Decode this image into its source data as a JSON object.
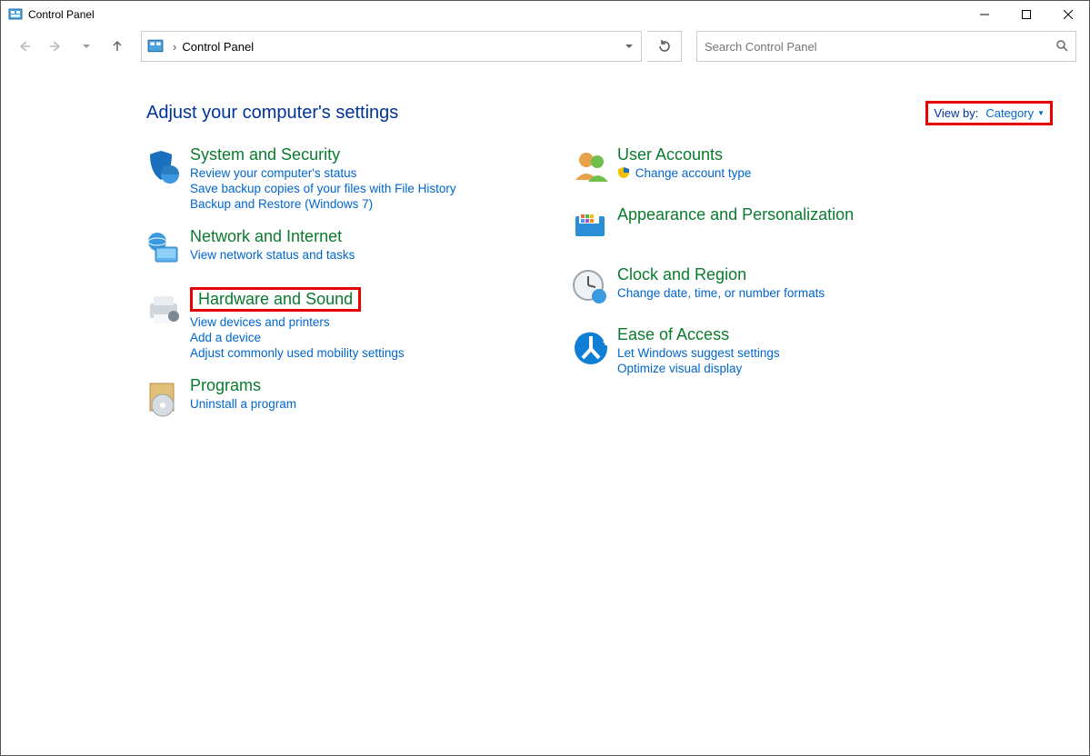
{
  "window": {
    "title": "Control Panel"
  },
  "address": {
    "location": "Control Panel"
  },
  "search": {
    "placeholder": "Search Control Panel"
  },
  "header": {
    "heading": "Adjust your computer's settings"
  },
  "viewby": {
    "label": "View by:",
    "value": "Category"
  },
  "left": [
    {
      "title": "System and Security",
      "links": [
        "Review your computer's status",
        "Save backup copies of your files with File History",
        "Backup and Restore (Windows 7)"
      ]
    },
    {
      "title": "Network and Internet",
      "links": [
        "View network status and tasks"
      ]
    },
    {
      "title": "Hardware and Sound",
      "boxed": true,
      "links": [
        "View devices and printers",
        "Add a device",
        "Adjust commonly used mobility settings"
      ]
    },
    {
      "title": "Programs",
      "links": [
        "Uninstall a program"
      ]
    }
  ],
  "right": [
    {
      "title": "User Accounts",
      "links": [
        {
          "shield": true,
          "text": "Change account type"
        }
      ]
    },
    {
      "title": "Appearance and Personalization",
      "links": []
    },
    {
      "title": "Clock and Region",
      "links": [
        "Change date, time, or number formats"
      ]
    },
    {
      "title": "Ease of Access",
      "links": [
        "Let Windows suggest settings",
        "Optimize visual display"
      ]
    }
  ],
  "highlights": {
    "color": "#e60000"
  }
}
